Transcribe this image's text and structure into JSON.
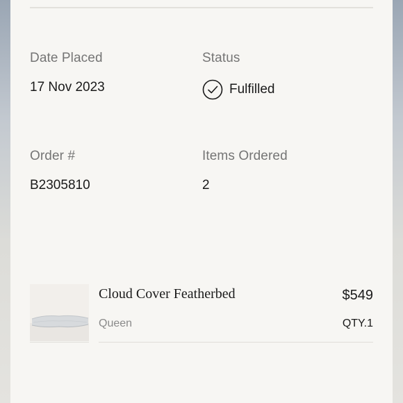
{
  "order": {
    "date_label": "Date Placed",
    "date_value": "17 Nov 2023",
    "status_label": "Status",
    "status_value": "Fulfilled",
    "status_icon": "check-circle-icon",
    "number_label": "Order #",
    "number_value": "B2305810",
    "items_label": "Items Ordered",
    "items_value": "2"
  },
  "items": [
    {
      "name": "Cloud Cover Featherbed",
      "variant": "Queen",
      "price": "$549",
      "qty": "QTY.1",
      "thumbnail": "featherbed-product-image"
    }
  ],
  "colors": {
    "card_bg": "#f7f6f3",
    "label": "#757575",
    "text": "#1a1a1a"
  }
}
